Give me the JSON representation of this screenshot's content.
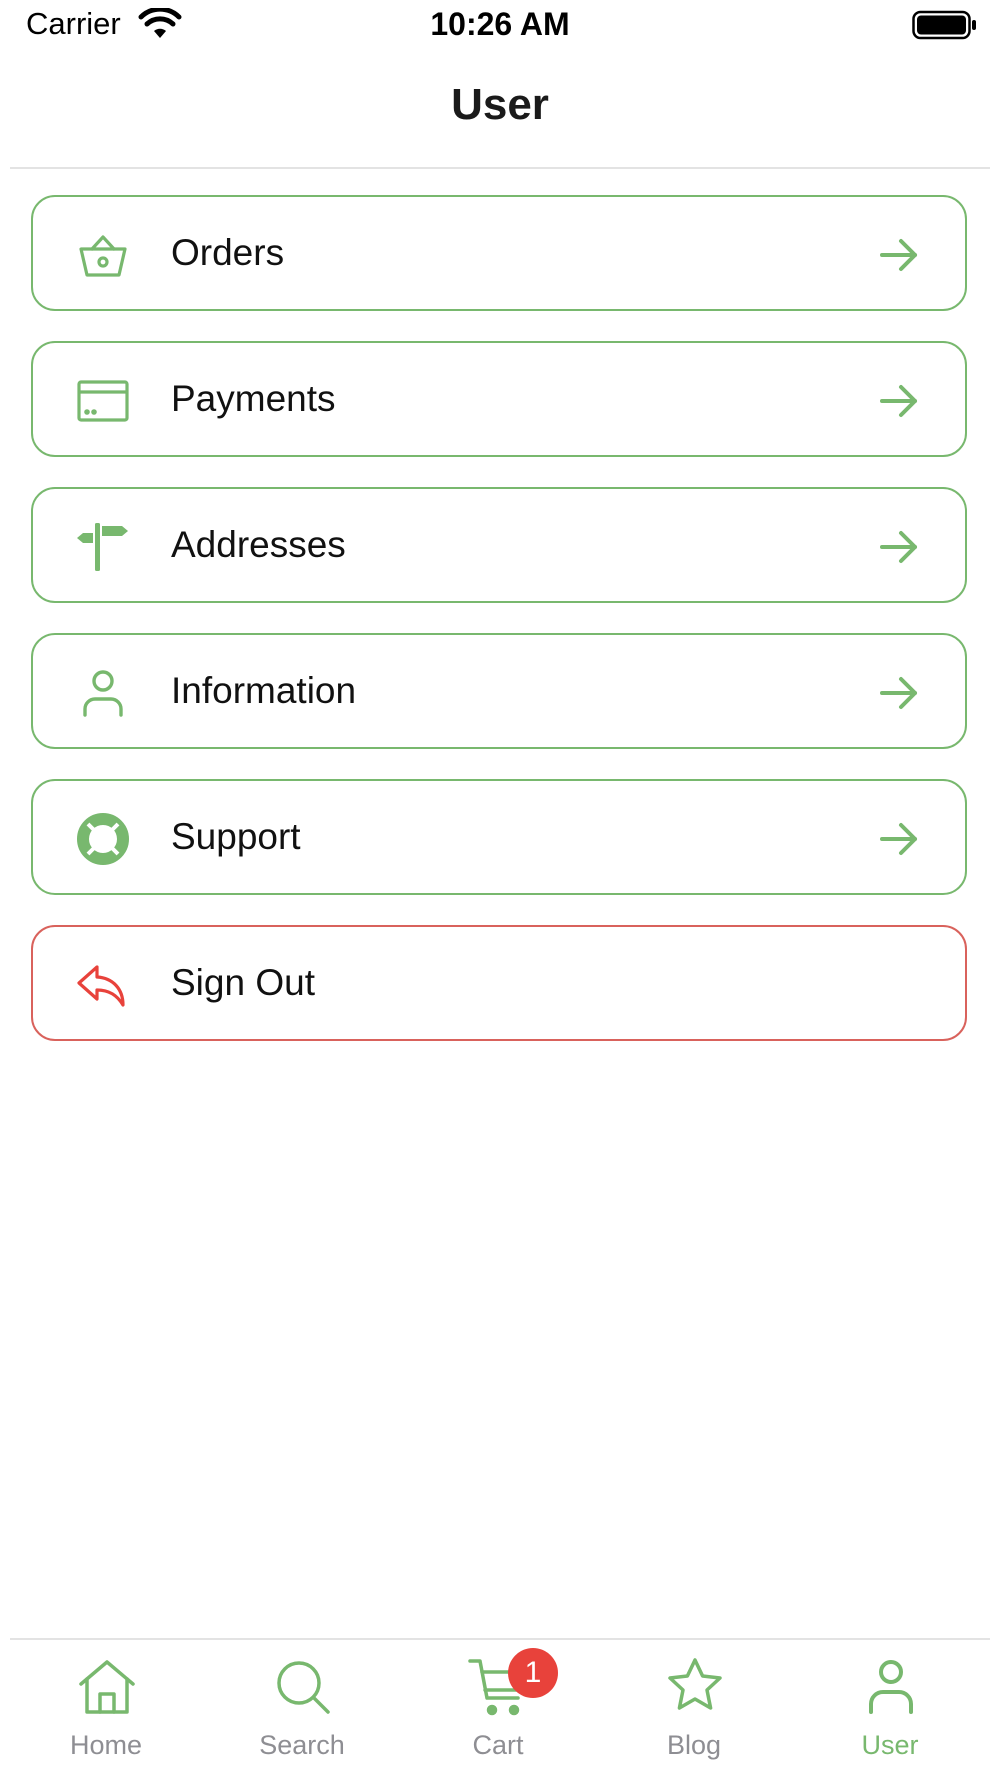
{
  "status_bar": {
    "carrier": "Carrier",
    "time": "10:26 AM"
  },
  "header": {
    "title": "User"
  },
  "menu": {
    "items": [
      {
        "label": "Orders",
        "icon": "basket-icon"
      },
      {
        "label": "Payments",
        "icon": "credit-card-icon"
      },
      {
        "label": "Addresses",
        "icon": "signpost-icon"
      },
      {
        "label": "Information",
        "icon": "person-icon"
      },
      {
        "label": "Support",
        "icon": "lifebuoy-icon"
      },
      {
        "label": "Sign Out",
        "icon": "sign-out-icon"
      }
    ]
  },
  "tabbar": {
    "tabs": [
      {
        "label": "Home",
        "icon": "home-icon"
      },
      {
        "label": "Search",
        "icon": "search-icon"
      },
      {
        "label": "Cart",
        "icon": "cart-icon"
      },
      {
        "label": "Blog",
        "icon": "star-icon"
      },
      {
        "label": "User",
        "icon": "user-icon"
      }
    ],
    "active_tab": "User",
    "cart_badge": "1"
  },
  "colors": {
    "accent_green": "#78b86e",
    "danger_red": "#d9625c",
    "badge_red": "#e8423b",
    "inactive_gray": "#8e8e93"
  }
}
